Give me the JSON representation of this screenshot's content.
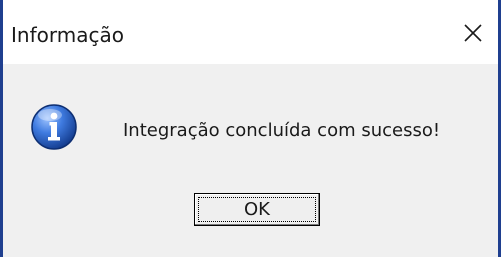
{
  "window": {
    "title": "Informação",
    "close_icon": "close-x-icon"
  },
  "dialog": {
    "icon": "information-icon",
    "message": "Integração concluída com sucesso!",
    "ok_label": "OK"
  },
  "colors": {
    "frame_border": "#1f3f8f",
    "title_bar": "#ffffff",
    "body": "#f0f0f0",
    "icon_blue": "#2a5fc9"
  }
}
